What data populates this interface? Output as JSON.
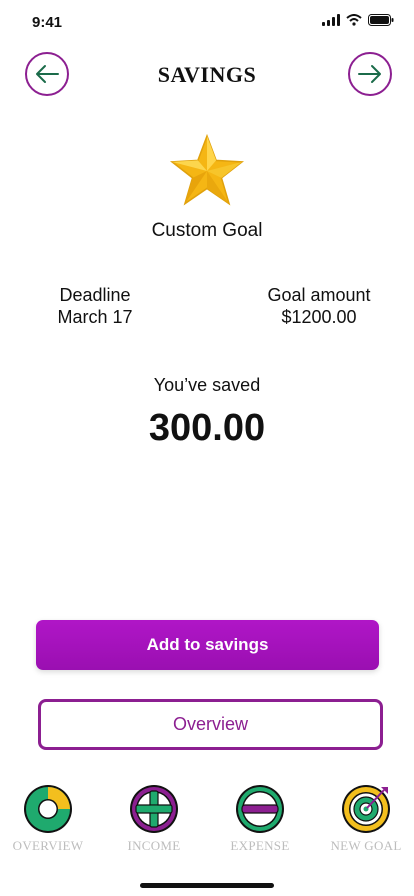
{
  "status_bar": {
    "time": "9:41"
  },
  "header": {
    "title": "SAVINGS",
    "back_icon": "arrow-left-icon",
    "forward_icon": "arrow-right-icon"
  },
  "goal": {
    "name": "Custom Goal",
    "icon": "star-icon"
  },
  "info": {
    "deadline_label": "Deadline",
    "deadline_value": "March 17",
    "goal_amount_label": "Goal amount",
    "goal_amount_value": "$1200.00"
  },
  "saved": {
    "label": "You’ve saved",
    "value": "300.00"
  },
  "actions": {
    "add_label": "Add to savings",
    "overview_label": "Overview"
  },
  "bottom_nav": {
    "items": [
      {
        "label": "OVERVIEW",
        "icon": "donut-chart-icon"
      },
      {
        "label": "INCOME",
        "icon": "plus-circle-icon"
      },
      {
        "label": "EXPENSE",
        "icon": "minus-circle-icon"
      },
      {
        "label": "NEW GOAL",
        "icon": "target-icon"
      }
    ]
  },
  "colors": {
    "accent": "#8c1f91",
    "primary_button": "#a613bc",
    "green": "#1faa6e",
    "yellow": "#f3bf1e"
  }
}
